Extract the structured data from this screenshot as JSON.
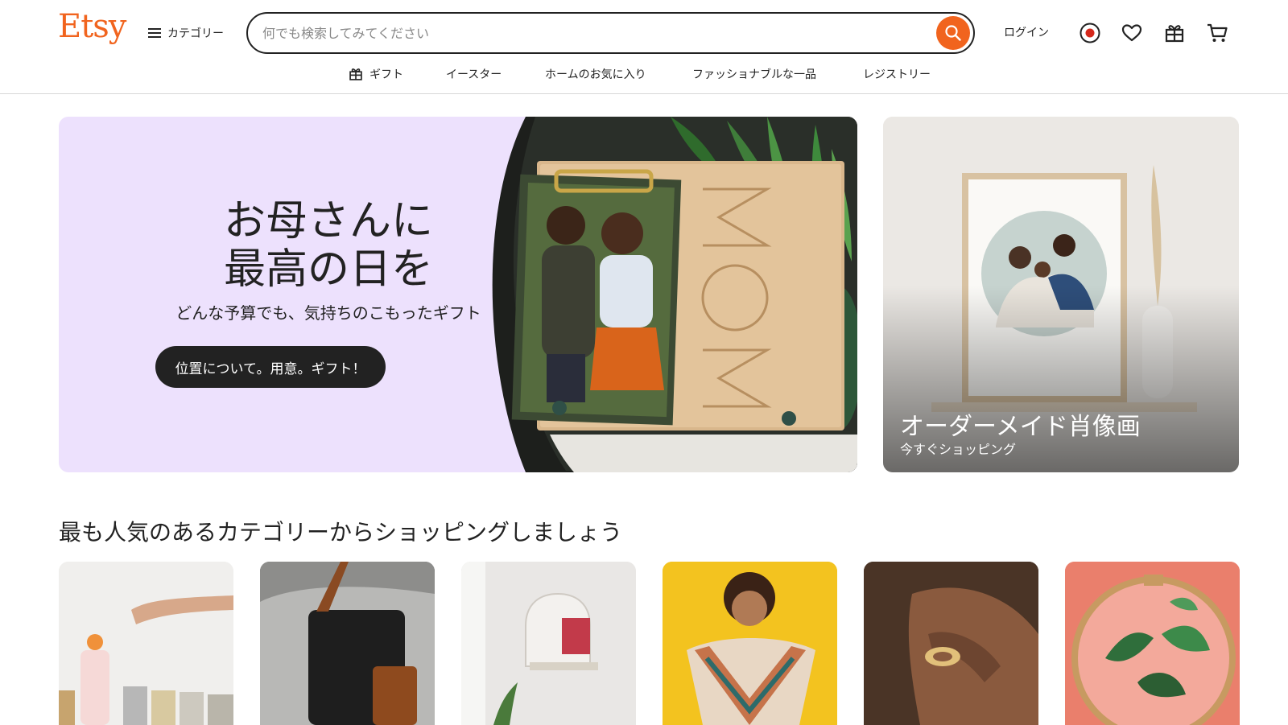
{
  "header": {
    "logo": "Etsy",
    "categories_label": "カテゴリー",
    "search_placeholder": "何でも検索してみてください",
    "login_label": "ログイン",
    "accent_color": "#f1641e"
  },
  "subnav": {
    "items": [
      {
        "label": "ギフト",
        "icon": "gift-icon"
      },
      {
        "label": "イースター"
      },
      {
        "label": "ホームのお気に入り"
      },
      {
        "label": "ファッショナブルな一品"
      },
      {
        "label": "レジストリー"
      }
    ]
  },
  "hero": {
    "title_line1": "お母さんに",
    "title_line2": "最高の日を",
    "subtitle": "どんな予算でも、気持ちのこもったギフト",
    "button_label": "位置について。用意。ギフト！",
    "background_color": "#ede1fd"
  },
  "side_card": {
    "title": "オーダーメイド肖像画",
    "subtitle": "今すぐショッピング"
  },
  "categories": {
    "title": "最も人気のあるカテゴリーからショッピングしましょう"
  }
}
